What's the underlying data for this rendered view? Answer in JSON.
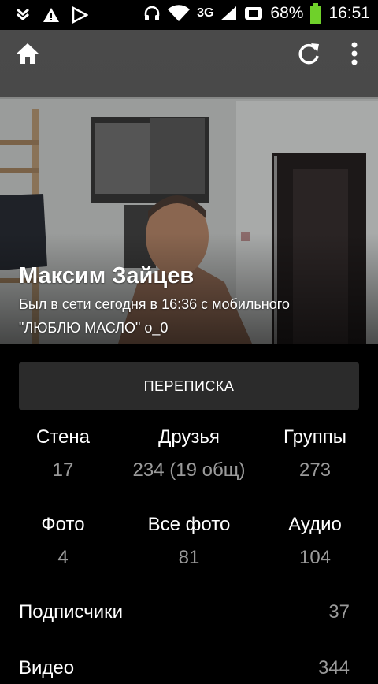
{
  "status_bar": {
    "battery": "68%",
    "time": "16:51",
    "network": "3G"
  },
  "profile": {
    "name": "Максим Зайцев",
    "online_status": "Был в сети сегодня в 16:36 с мобильного",
    "bio": "\"ЛЮБЛЮ МАСЛО\" o_0"
  },
  "actions": {
    "messages_label": "ПЕРЕПИСКА"
  },
  "stats_row1": [
    {
      "label": "Стена",
      "value": "17"
    },
    {
      "label": "Друзья",
      "value": "234 (19 общ)"
    },
    {
      "label": "Группы",
      "value": "273"
    }
  ],
  "stats_row2": [
    {
      "label": "Фото",
      "value": "4"
    },
    {
      "label": "Все фото",
      "value": "81"
    },
    {
      "label": "Аудио",
      "value": "104"
    }
  ],
  "list": [
    {
      "label": "Подписчики",
      "value": "37"
    },
    {
      "label": "Видео",
      "value": "344"
    }
  ],
  "icons": {
    "home": "home-icon",
    "refresh": "refresh-icon",
    "more": "more-vert-icon"
  },
  "colors": {
    "background": "#000000",
    "button": "#2b2b2b",
    "muted_text": "#9a9a9a",
    "battery": "#6fd12a"
  }
}
